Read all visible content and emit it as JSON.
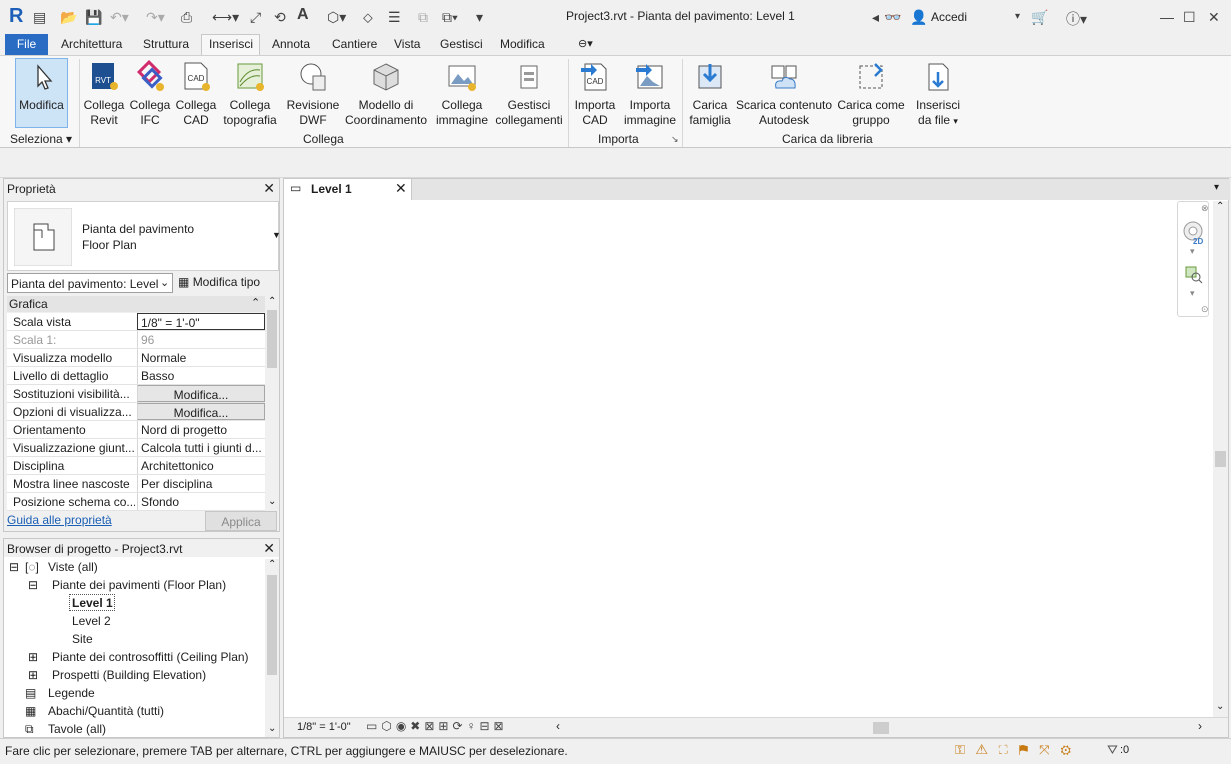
{
  "window": {
    "title": "Project3.rvt - Pianta del pavimento: Level 1",
    "sign_in": "Accedi",
    "app_letter": "R"
  },
  "menu": {
    "file": "File",
    "tabs": [
      "Architettura",
      "Struttura",
      "Inserisci",
      "Annota",
      "Cantiere",
      "Vista",
      "Gestisci",
      "Modifica"
    ]
  },
  "ribbon": {
    "select": {
      "button": "Modifica",
      "panel": "Seleziona"
    },
    "link_buttons": [
      [
        "Collega",
        "Revit"
      ],
      [
        "Collega",
        "IFC"
      ],
      [
        "Collega",
        "CAD"
      ],
      [
        "Collega",
        "topografia"
      ],
      [
        "Revisione",
        "DWF"
      ],
      [
        "Modello di",
        "Coordinamento"
      ],
      [
        "Collega",
        "immagine"
      ],
      [
        "Gestisci",
        "collegamenti"
      ]
    ],
    "link_panel": "Collega",
    "import_buttons": [
      [
        "Importa",
        "CAD"
      ],
      [
        "Importa",
        "immagine"
      ]
    ],
    "import_panel": "Importa",
    "library_buttons": [
      [
        "Carica",
        "famiglia"
      ],
      [
        "Scarica contenuto",
        "Autodesk"
      ],
      [
        "Carica come",
        "gruppo"
      ],
      [
        "Inserisci",
        "da file"
      ]
    ],
    "library_panel": "Carica da libreria",
    "icon_text": {
      "rvt": "RVT",
      "cad": "CAD"
    }
  },
  "properties": {
    "title": "Proprietà",
    "type_line1": "Pianta del pavimento",
    "type_line2": "Floor Plan",
    "selector": "Pianta del pavimento: Level",
    "edit_type": "Modifica tipo",
    "section": "Grafica",
    "rows": [
      {
        "key": "Scala vista",
        "value": "1/8\" = 1'-0\""
      },
      {
        "key": "Scala  1:",
        "value": "96"
      },
      {
        "key": "Visualizza modello",
        "value": "Normale"
      },
      {
        "key": "Livello di dettaglio",
        "value": "Basso"
      },
      {
        "key": "Sostituzioni visibilità...",
        "value": "Modifica..."
      },
      {
        "key": "Opzioni di visualizza...",
        "value": "Modifica..."
      },
      {
        "key": "Orientamento",
        "value": "Nord di progetto"
      },
      {
        "key": "Visualizzazione giunt...",
        "value": "Calcola tutti i giunti d..."
      },
      {
        "key": "Disciplina",
        "value": "Architettonico"
      },
      {
        "key": "Mostra linee nascoste",
        "value": "Per disciplina"
      },
      {
        "key": "Posizione schema co...",
        "value": "Sfondo"
      }
    ],
    "help_link": "Guida alle proprietà",
    "apply": "Applica"
  },
  "browser": {
    "title": "Browser di progetto - Project3.rvt",
    "items": [
      "Viste (all)",
      "Piante dei pavimenti (Floor Plan)",
      "Level 1",
      "Level 2",
      "Site",
      "Piante dei controsoffitti (Ceiling Plan)",
      "Prospetti (Building Elevation)",
      "Legende",
      "Abachi/Quantità (tutti)",
      "Tavole (all)"
    ]
  },
  "view": {
    "tab": "Level 1",
    "scale": "1/8\" = 1'-0\"",
    "nav_2d": "2D"
  },
  "status": {
    "text": "Fare clic per selezionare, premere TAB per alternare, CTRL per aggiungere e MAIUSC per deselezionare.",
    "filter_count": ":0"
  }
}
